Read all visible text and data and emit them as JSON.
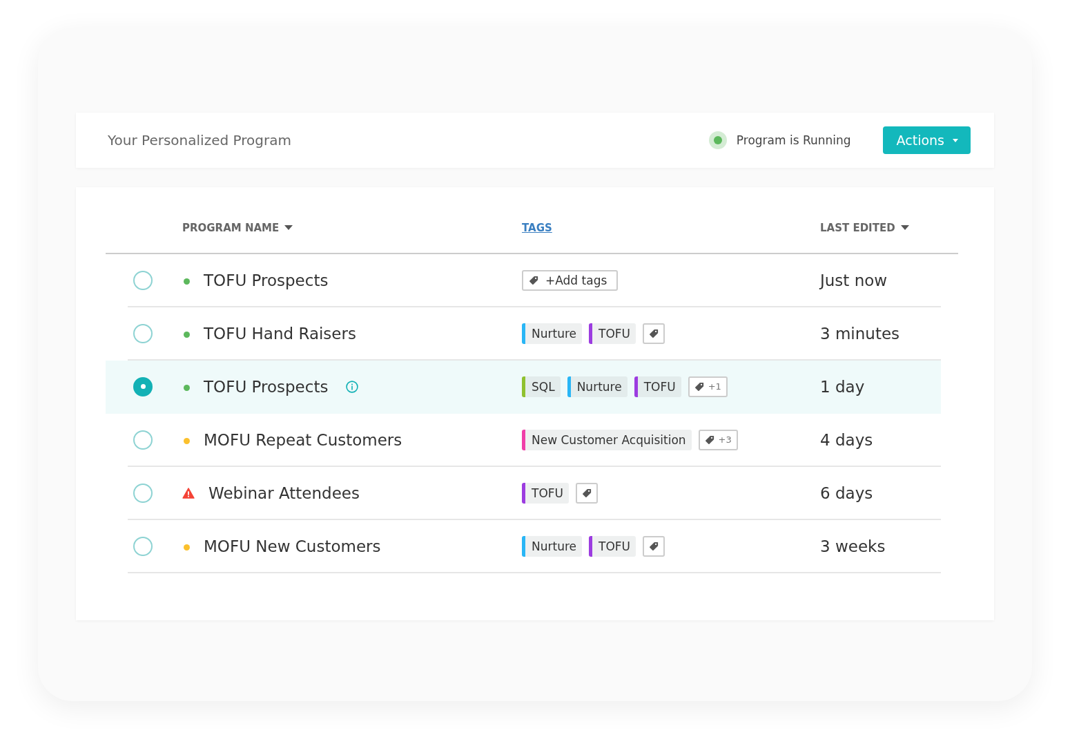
{
  "header": {
    "title": "Your Personalized Program",
    "status": {
      "label": "Program is Running",
      "color": "#5cb85c"
    },
    "actions_button": "Actions"
  },
  "table": {
    "columns": [
      {
        "label": "PROGRAM NAME",
        "kind": "sort"
      },
      {
        "label": "TAGS",
        "kind": "link"
      },
      {
        "label": "LAST EDITED",
        "kind": "sort"
      }
    ],
    "rows": [
      {
        "selected": false,
        "status": {
          "kind": "dot",
          "color": "#5cb85c"
        },
        "name": "TOFU Prospects",
        "info": false,
        "tags": [],
        "add_tags_button": "+Add tags",
        "last_edited": "Just now"
      },
      {
        "selected": false,
        "status": {
          "kind": "dot",
          "color": "#5cb85c"
        },
        "name": "TOFU Hand Raisers",
        "info": false,
        "tags": [
          {
            "label": "Nurture",
            "color": "#29b6f6"
          },
          {
            "label": "TOFU",
            "color": "#9c3ce0"
          }
        ],
        "tag_action": {
          "kind": "icon"
        },
        "last_edited": "3 minutes"
      },
      {
        "selected": true,
        "status": {
          "kind": "dot",
          "color": "#5cb85c"
        },
        "name": "TOFU Prospects",
        "info": true,
        "tags": [
          {
            "label": "SQL",
            "color": "#8fc12f"
          },
          {
            "label": "Nurture",
            "color": "#29b6f6"
          },
          {
            "label": "TOFU",
            "color": "#9c3ce0"
          }
        ],
        "tag_action": {
          "kind": "count",
          "label": "+1"
        },
        "last_edited": "1 day"
      },
      {
        "selected": false,
        "status": {
          "kind": "dot",
          "color": "#fbc02d"
        },
        "name": "MOFU Repeat Customers",
        "info": false,
        "tags": [
          {
            "label": "New Customer Acquisition",
            "color": "#f03ea8"
          }
        ],
        "tag_action": {
          "kind": "count",
          "label": "+3"
        },
        "last_edited": "4 days"
      },
      {
        "selected": false,
        "status": {
          "kind": "warning"
        },
        "name": "Webinar Attendees",
        "info": false,
        "tags": [
          {
            "label": "TOFU",
            "color": "#9c3ce0"
          }
        ],
        "tag_action": {
          "kind": "icon"
        },
        "last_edited": "6 days"
      },
      {
        "selected": false,
        "status": {
          "kind": "dot",
          "color": "#fbc02d"
        },
        "name": "MOFU New Customers",
        "info": false,
        "tags": [
          {
            "label": "Nurture",
            "color": "#29b6f6"
          },
          {
            "label": "TOFU",
            "color": "#9c3ce0"
          }
        ],
        "tag_action": {
          "kind": "icon"
        },
        "last_edited": "3 weeks"
      }
    ]
  }
}
